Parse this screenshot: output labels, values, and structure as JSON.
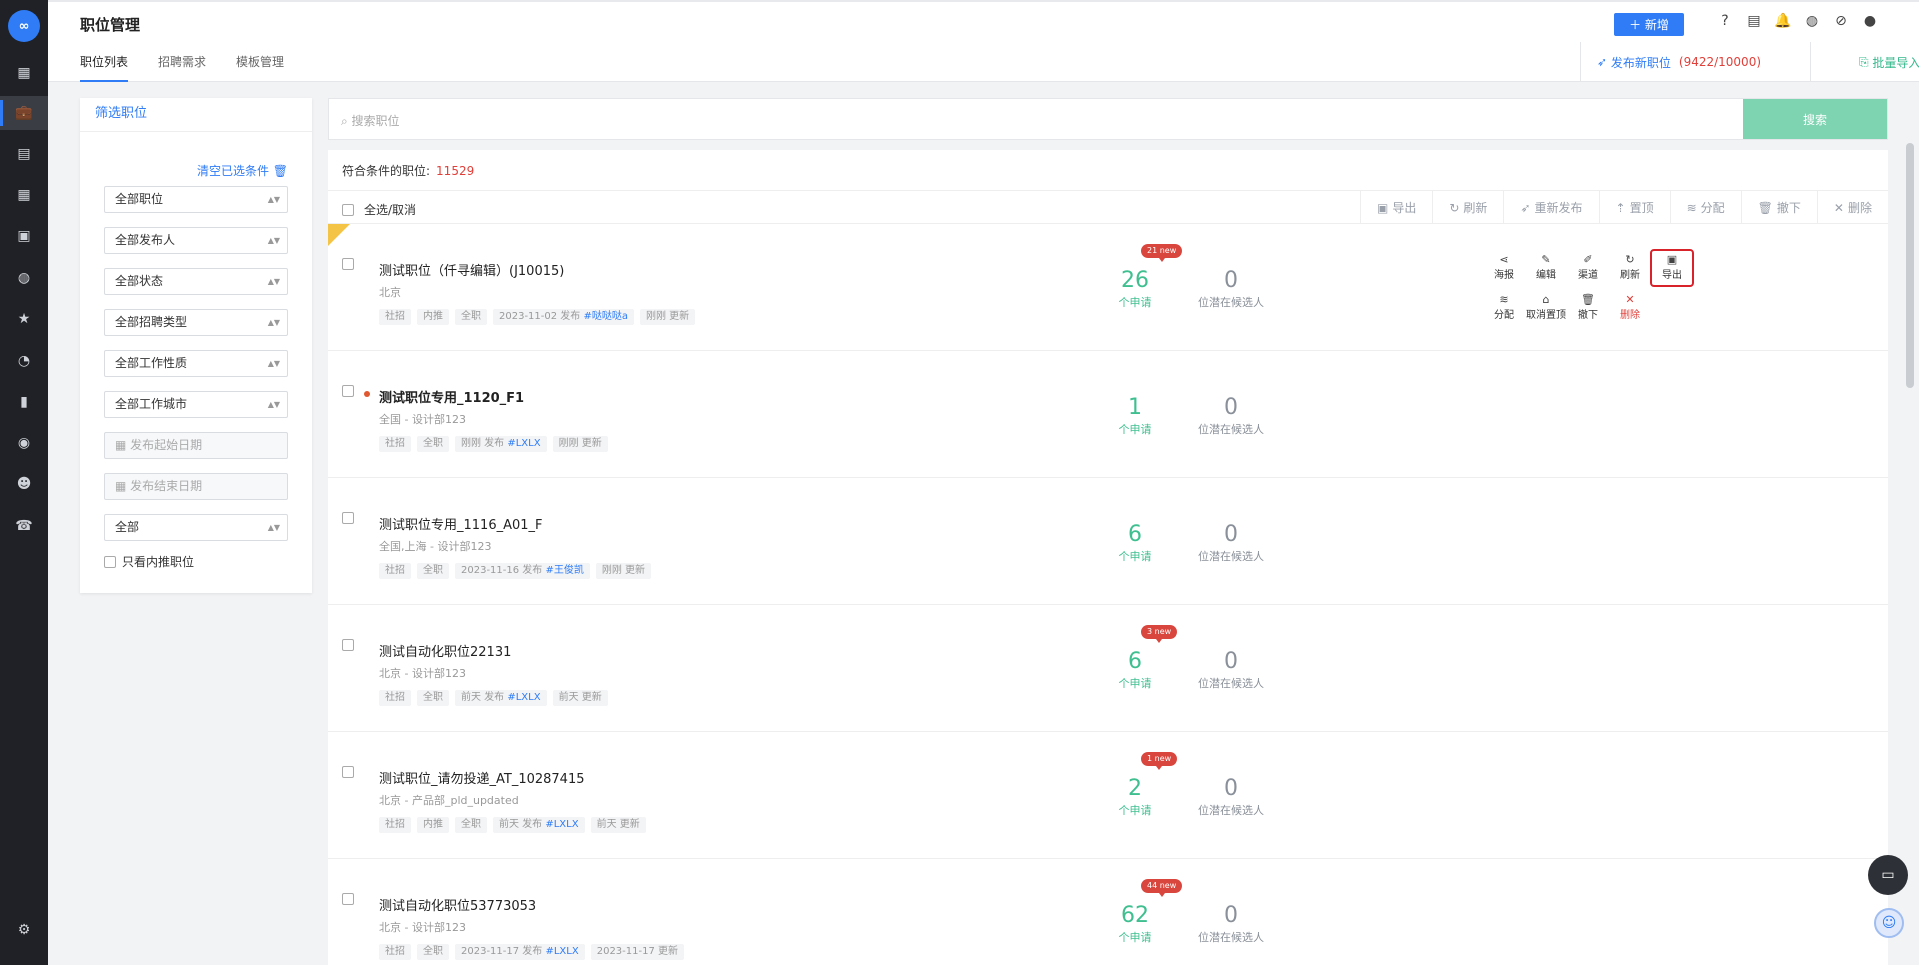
{
  "app": {
    "logo_text": "∞",
    "page_title": "职位管理",
    "add_button": "＋ 新增"
  },
  "sidebar": {
    "items": [
      {
        "name": "dashboard-icon",
        "glyph": "▦"
      },
      {
        "name": "briefcase-icon",
        "glyph": "💼"
      },
      {
        "name": "report-icon",
        "glyph": "▤"
      },
      {
        "name": "calendar-icon",
        "glyph": "▦"
      },
      {
        "name": "contact-card-icon",
        "glyph": "▣"
      },
      {
        "name": "wechat-icon",
        "glyph": "◍"
      },
      {
        "name": "star-icon",
        "glyph": "★"
      },
      {
        "name": "pie-chart-icon",
        "glyph": "◔"
      },
      {
        "name": "bar-chart-icon",
        "glyph": "▮"
      },
      {
        "name": "user-circle-icon",
        "glyph": "◉"
      },
      {
        "name": "people-icon",
        "glyph": "☻"
      },
      {
        "name": "phone-icon",
        "glyph": "☎"
      }
    ],
    "settings_glyph": "⚙"
  },
  "topbar": {
    "icons": [
      "help-icon",
      "document-icon",
      "bell-icon",
      "headset-icon",
      "compass-icon",
      "account-icon"
    ],
    "icon_glyphs": [
      "?",
      "▤",
      "🔔",
      "◍",
      "⊘",
      "●"
    ]
  },
  "tabs": [
    "职位列表",
    "招聘需求",
    "模板管理"
  ],
  "publish": {
    "label": "发布新职位",
    "count": "(9422/10000)"
  },
  "bulk_import": "批量导入职位",
  "filters": {
    "title": "筛选职位",
    "clear": "清空已选条件 🗑",
    "selects": [
      "全部职位",
      "全部发布人",
      "全部状态",
      "全部招聘类型",
      "全部工作性质",
      "全部工作城市"
    ],
    "start_date": "发布起始日期",
    "end_date": "发布结束日期",
    "last_select": "全部",
    "only_inner": "只看内推职位"
  },
  "search": {
    "placeholder": "搜索职位",
    "button": "搜索"
  },
  "result": {
    "label": "符合条件的职位:",
    "count": "11529"
  },
  "bulk_bar": {
    "select_all": "全选/取消",
    "actions": [
      "导出",
      "刷新",
      "重新发布",
      "置顶",
      "分配",
      "撤下",
      "删除"
    ]
  },
  "labels": {
    "applications": "个申请",
    "candidates": "位潜在候选人"
  },
  "jobs": [
    {
      "title": "测试职位（仟寻编辑）(J10015)",
      "location": "北京",
      "tags": [
        "社招",
        "内推",
        "全职"
      ],
      "publish": "2023-11-02 发布 ",
      "publisher": "#哒哒哒a",
      "updated": "刚刚 更新",
      "applications": "26",
      "candidates": "0",
      "new": "21 new",
      "pinned": true,
      "bold": false,
      "dot": false
    },
    {
      "title": "测试职位专用_1120_F1",
      "location": "全国 - 设计部123",
      "tags": [
        "社招",
        "全职"
      ],
      "publish": "刚刚 发布 ",
      "publisher": "#LXLX",
      "updated": "刚刚 更新",
      "applications": "1",
      "candidates": "0",
      "new": "",
      "pinned": false,
      "bold": true,
      "dot": true
    },
    {
      "title": "测试职位专用_1116_A01_F",
      "location": "全国,上海 - 设计部123",
      "tags": [
        "社招",
        "全职"
      ],
      "publish": "2023-11-16 发布 ",
      "publisher": "#王俊凯",
      "updated": "刚刚 更新",
      "applications": "6",
      "candidates": "0",
      "new": "",
      "pinned": false,
      "bold": false,
      "dot": false
    },
    {
      "title": "测试自动化职位22131",
      "location": "北京 - 设计部123",
      "tags": [
        "社招",
        "全职"
      ],
      "publish": "前天 发布 ",
      "publisher": "#LXLX",
      "updated": "前天 更新",
      "applications": "6",
      "candidates": "0",
      "new": "3 new",
      "pinned": false,
      "bold": false,
      "dot": false
    },
    {
      "title": "测试职位_请勿投递_AT_10287415",
      "location": "北京 - 产品部_pld_updated",
      "tags": [
        "社招",
        "内推",
        "全职"
      ],
      "publish": "前天 发布 ",
      "publisher": "#LXLX",
      "updated": "前天 更新",
      "applications": "2",
      "candidates": "0",
      "new": "1 new",
      "pinned": false,
      "bold": false,
      "dot": false
    },
    {
      "title": "测试自动化职位53773053",
      "location": "北京 - 设计部123",
      "tags": [
        "社招",
        "全职"
      ],
      "publish": "2023-11-17 发布 ",
      "publisher": "#LXLX",
      "updated": "2023-11-17 更新",
      "applications": "62",
      "candidates": "0",
      "new": "44 new",
      "pinned": false,
      "bold": false,
      "dot": false
    }
  ],
  "row_ops": {
    "top": [
      "海报",
      "编辑",
      "渠道",
      "刷新",
      "导出"
    ],
    "bottom": [
      "分配",
      "取消置顶",
      "撤下",
      "删除"
    ],
    "top_glyphs": [
      "⋖",
      "✎",
      "✐",
      "↻",
      "▣"
    ],
    "bottom_glyphs": [
      "≋",
      "⌂",
      "🗑",
      "✕"
    ]
  },
  "colors": {
    "accent": "#2f7cf6",
    "green": "#3fbf90",
    "red": "#e0403a",
    "sidebar": "#1f2126"
  }
}
